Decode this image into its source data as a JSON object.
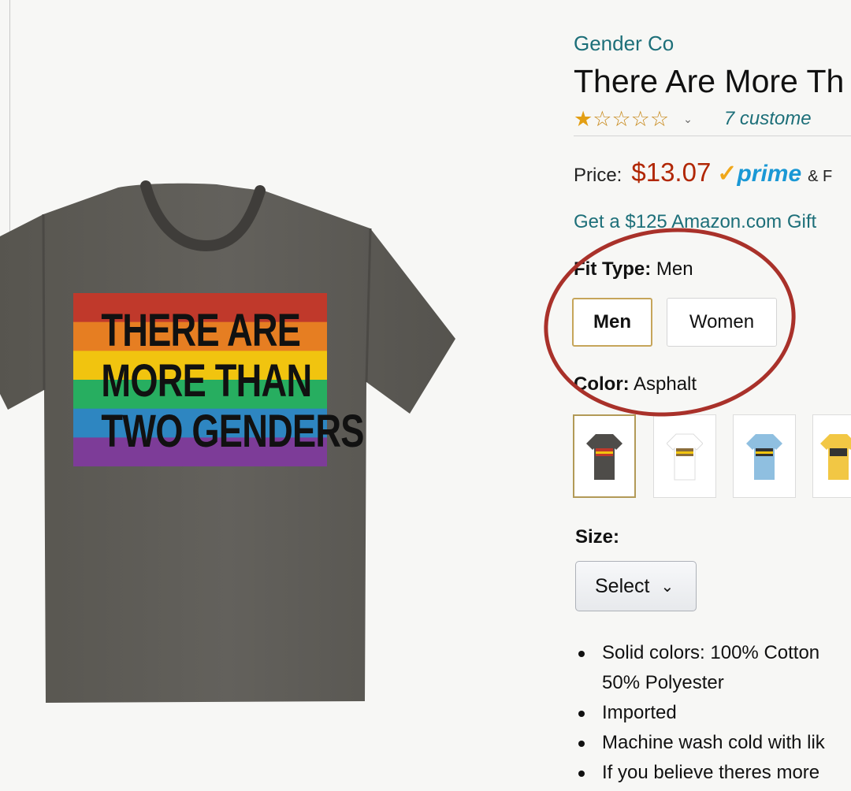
{
  "product": {
    "brand": "Gender Co",
    "title": "There Are More Th",
    "rating": 1,
    "rating_max": 5,
    "reviews_text": "7 custome",
    "price_label": "Price:",
    "price": "$13.07",
    "prime": "prime",
    "prime_suffix": "& F",
    "gift_offer": "Get a $125 Amazon.com Gift",
    "image": {
      "print_lines": [
        "THERE ARE",
        "MORE THAN",
        "TWO GENDERS"
      ],
      "shirt_color": "#5d5b58",
      "stripe_colors": [
        "#c0392b",
        "#e67e22",
        "#f1c40f",
        "#27ae60",
        "#2e86c1",
        "#7d3c98"
      ]
    }
  },
  "fit_type": {
    "label": "Fit Type:",
    "value": "Men",
    "options": [
      "Men",
      "Women"
    ],
    "selected": "Men"
  },
  "color": {
    "label": "Color:",
    "value": "Asphalt",
    "swatches": [
      {
        "name": "Asphalt",
        "hex": "#4e4c49"
      },
      {
        "name": "white",
        "hex": "#ffffff"
      },
      {
        "name": "light-blue",
        "hex": "#8fbfe0"
      },
      {
        "name": "yellow",
        "hex": "#f2c744"
      }
    ]
  },
  "size": {
    "label": "Size:",
    "selected": "Select"
  },
  "bullets": [
    {
      "text": "Solid colors: 100% Cotton",
      "cont": "50% Polyester"
    },
    {
      "text": "Imported"
    },
    {
      "text": "Machine wash cold with lik"
    },
    {
      "text": "If you believe theres more"
    }
  ],
  "colors": {
    "link": "#1d6f79",
    "price": "#b12704",
    "prime": "#1a98d5",
    "star": "#e39f14",
    "annotation_ring": "#a9312a"
  }
}
